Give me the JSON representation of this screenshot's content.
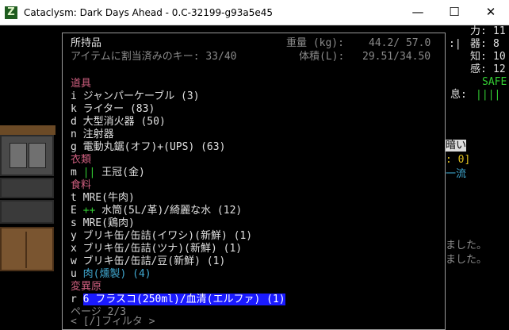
{
  "window": {
    "title": "Cataclysm: Dark Days Ahead - 0.C-32199-g93a5e45",
    "app_icon": "Z",
    "minimize_glyph": "—",
    "maximize_glyph": "☐",
    "close_glyph": "✕"
  },
  "inventory": {
    "title": "所持品",
    "assigned_keys": "アイテムに割当済みのキー: 33/40",
    "weight_label": "重量 (kg):",
    "weight_value": "44.2/ 57.0",
    "volume_label": "体積(L):",
    "volume_value": "29.51/34.50",
    "rows": [
      {
        "type": "cat",
        "text": "道具"
      },
      {
        "type": "item",
        "key": "i",
        "text": "ジャンパーケーブル (3)"
      },
      {
        "type": "item",
        "key": "k",
        "text": "ライター (83)"
      },
      {
        "type": "item",
        "key": "d",
        "text": "大型消火器 (50)"
      },
      {
        "type": "item",
        "key": "n",
        "text": "注射器"
      },
      {
        "type": "item",
        "key": "g",
        "text": "電動丸鋸(オフ)+(UPS) (63)"
      },
      {
        "type": "cat",
        "text": "衣類"
      },
      {
        "type": "item",
        "key": "m",
        "marker": "||",
        "text": "王冠(金)"
      },
      {
        "type": "cat",
        "text": "食料"
      },
      {
        "type": "item",
        "key": "t",
        "text": "MRE(牛肉)"
      },
      {
        "type": "item",
        "key": "E",
        "marker": "++",
        "text": "水筒(5L/革)/綺麗な水 (12)"
      },
      {
        "type": "item",
        "key": "s",
        "text": "MRE(鶏肉)"
      },
      {
        "type": "item",
        "key": "y",
        "text": "ブリキ缶/缶詰(イワシ)(新鮮) (1)"
      },
      {
        "type": "item",
        "key": "x",
        "text": "ブリキ缶/缶詰(ツナ)(新鮮) (1)"
      },
      {
        "type": "item",
        "key": "w",
        "text": "ブリキ缶/缶詰/豆(新鮮) (1)"
      },
      {
        "type": "item",
        "key": "u",
        "text": "肉(燻製) (4)",
        "color": "cyan"
      },
      {
        "type": "cat",
        "text": "変異原"
      },
      {
        "type": "item",
        "key": "r",
        "text": "6 フラスコ(250ml)/血清(エルファ) (1)",
        "selected": true
      },
      {
        "type": "footer",
        "text": "ページ 2/3"
      }
    ],
    "filter": "< [/]フィルタ >"
  },
  "side": {
    "stat_labels": [
      "力:",
      "器:",
      "知:",
      "感:"
    ],
    "stat_values": [
      "11",
      "8",
      "10",
      "12"
    ],
    "bar_mark": ":|",
    "safe": "SAFE",
    "focus_label": "息:",
    "focus_bar": "||||",
    "dark_label": "暗い",
    "colon_zero": ": 0]",
    "style_text": "一流",
    "log_1": "ました。",
    "log_2": "ました。"
  }
}
